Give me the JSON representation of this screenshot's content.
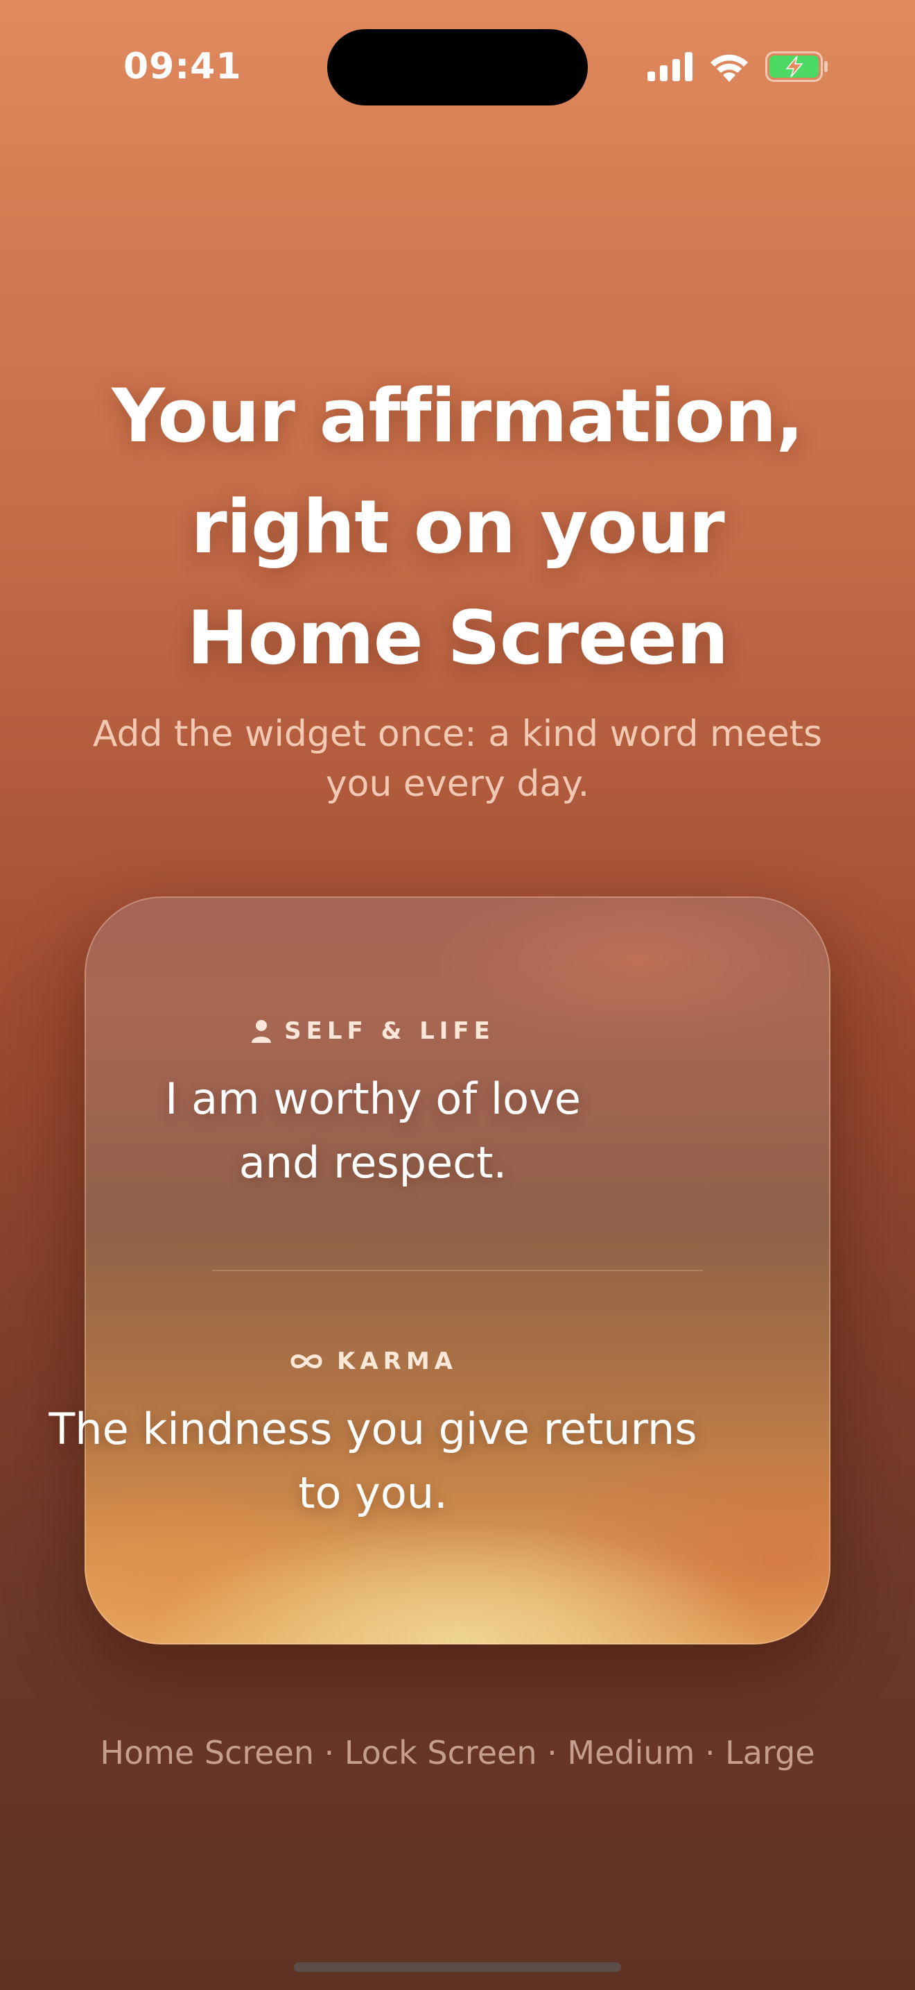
{
  "status_bar": {
    "time": "09:41",
    "icons": [
      "cellular-signal-icon",
      "wifi-icon",
      "battery-charging-icon"
    ],
    "battery_color": "#4cd964"
  },
  "headline": {
    "lines": [
      "Your affirmation,",
      "right on your",
      "Home Screen"
    ]
  },
  "subtitle": {
    "lines": [
      "Add the widget once: a kind word meets",
      "you every day."
    ]
  },
  "widget": {
    "items": [
      {
        "category": "SELF & LIFE",
        "icon": "person-icon",
        "text_lines": [
          "I am worthy of love",
          "and respect."
        ]
      },
      {
        "category": "KARMA",
        "icon": "infinity-icon",
        "text_lines": [
          "The kindness you give returns",
          "to you."
        ]
      }
    ]
  },
  "platforms": "Home Screen · Lock Screen · Medium · Large",
  "colors": {
    "background_top": "#e08a5e",
    "background_bottom": "#5d3324"
  }
}
